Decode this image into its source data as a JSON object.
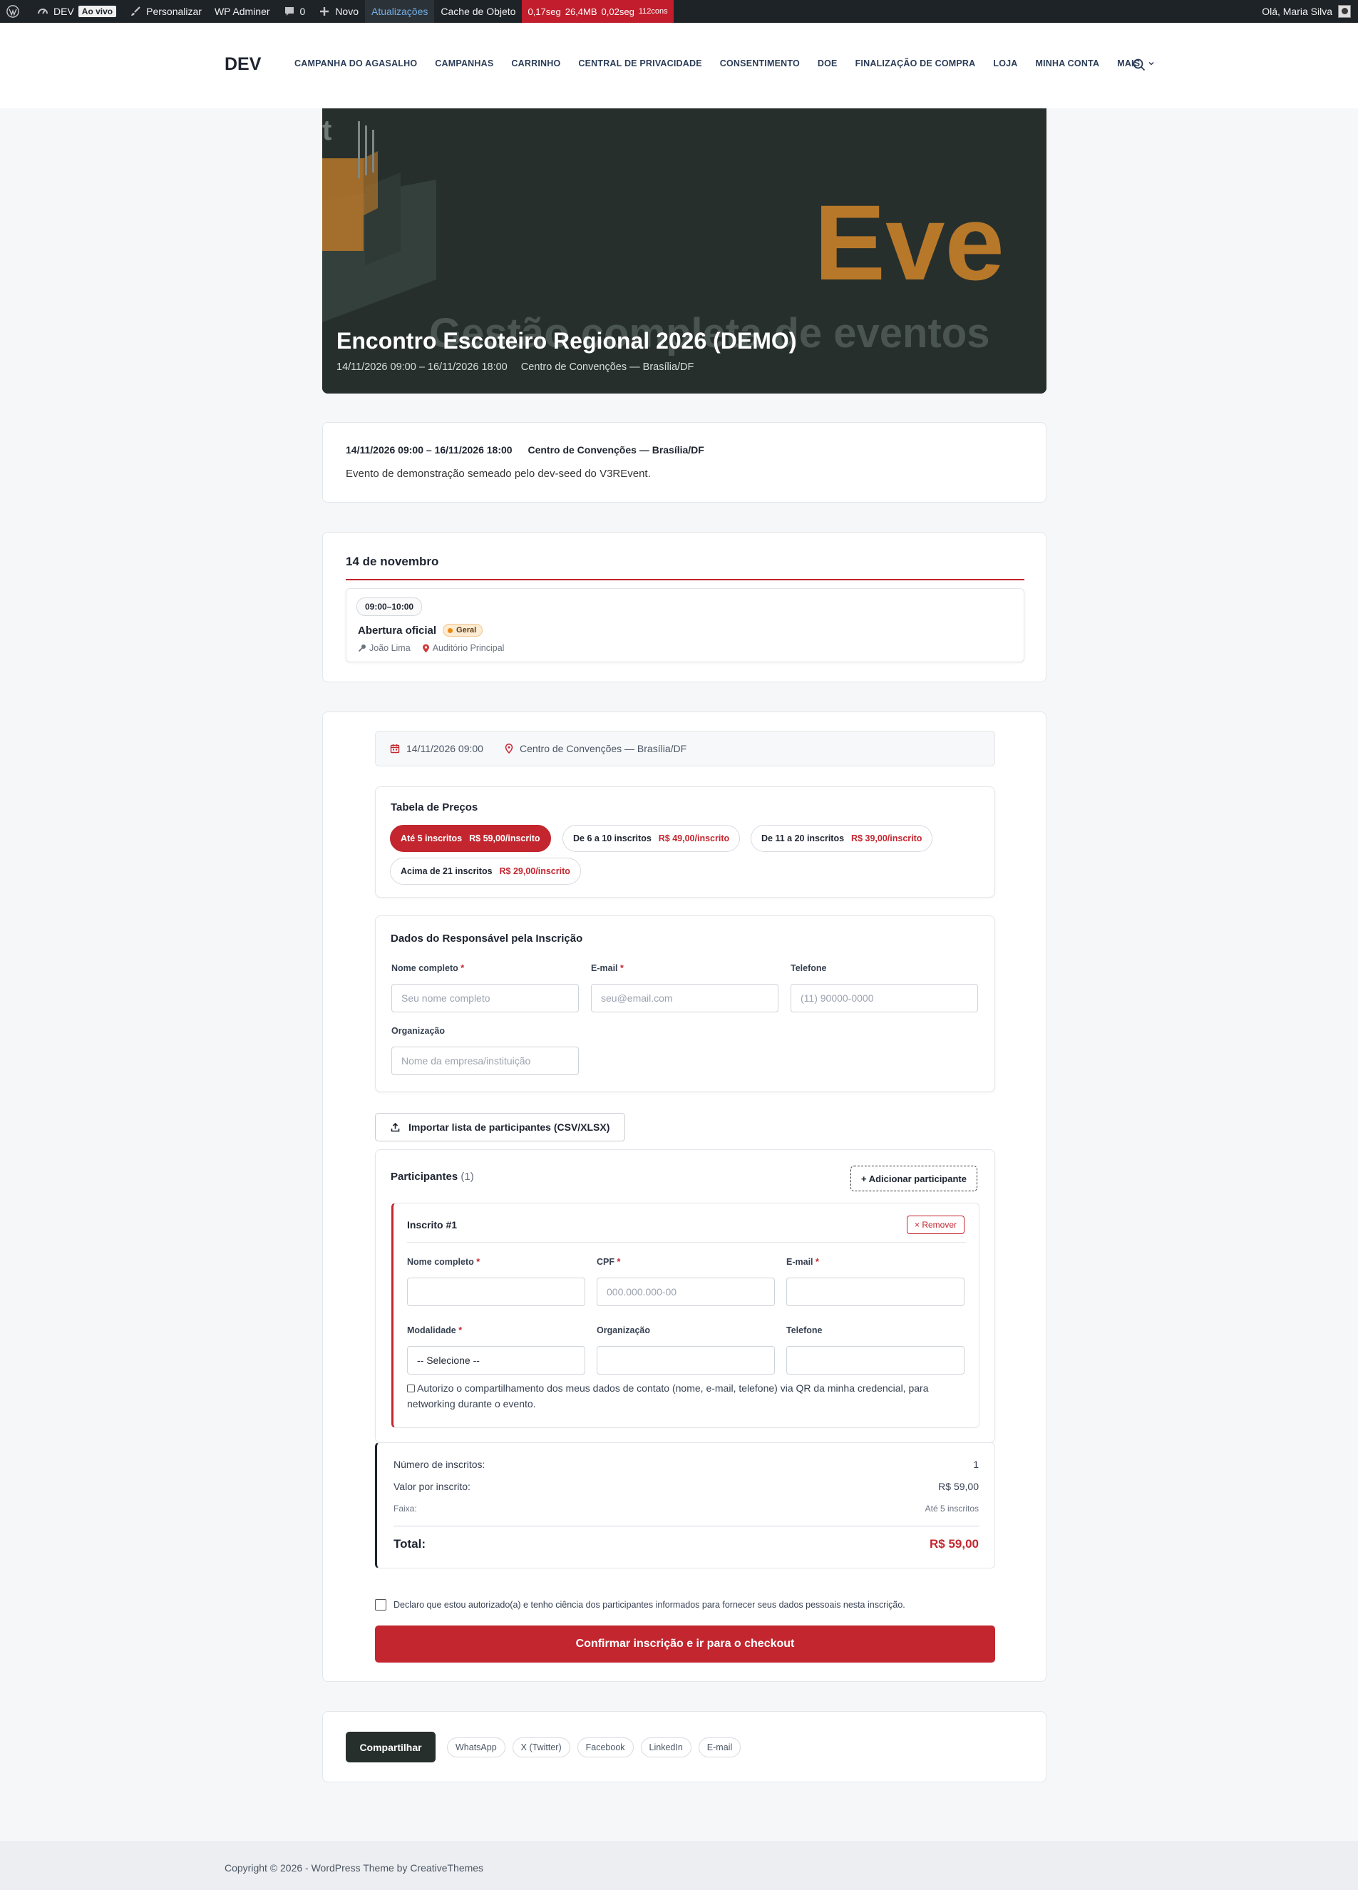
{
  "admin_bar": {
    "site_name": "DEV",
    "live_badge": "Ao vivo",
    "customize": "Personalizar",
    "wp_adminer": "WP Adminer",
    "comments_count": "0",
    "new": "Novo",
    "updates": "Atualizações",
    "object_cache": "Cache de Objeto",
    "perf": {
      "time1": "0,17seg",
      "memory": "26,4MB",
      "time2": "0,02seg",
      "queries": "112cons"
    },
    "greeting": "Olá, Maria Silva"
  },
  "header": {
    "logo": "DEV",
    "nav": [
      "CAMPANHA DO AGASALHO",
      "CAMPANHAS",
      "CARRINHO",
      "CENTRAL DE PRIVACIDADE",
      "CONSENTIMENTO",
      "DOE",
      "FINALIZAÇÃO DE COMPRA",
      "LOJA",
      "MINHA CONTA",
      "MAIS"
    ]
  },
  "hero": {
    "title": "Encontro Escoteiro Regional 2026 (DEMO)",
    "dates": "14/11/2026 09:00 – 16/11/2026 18:00",
    "location": "Centro de Convenções — Brasília/DF",
    "banner_text_big": "Eve",
    "banner_text_sub": "Gestão completa de eventos",
    "banner_corner": "t"
  },
  "info": {
    "dates": "14/11/2026 09:00 – 16/11/2026 18:00",
    "location": "Centro de Convenções — Brasília/DF",
    "description": "Evento de demonstração semeado pelo dev-seed do V3REvent."
  },
  "schedule": {
    "day": "14 de novembro",
    "session": {
      "time": "09:00–10:00",
      "title": "Abertura oficial",
      "category": "Geral",
      "speaker": "João Lima",
      "room": "Auditório Principal"
    }
  },
  "registration": {
    "when_date": "14/11/2026 09:00",
    "when_location": "Centro de Convenções — Brasília/DF",
    "pricing_title": "Tabela de Preços",
    "tiers": [
      {
        "label": "Até 5 inscritos",
        "price": "R$ 59,00/inscrito"
      },
      {
        "label": "De 6 a 10 inscritos",
        "price": "R$ 49,00/inscrito"
      },
      {
        "label": "De 11 a 20 inscritos",
        "price": "R$ 39,00/inscrito"
      },
      {
        "label": "Acima de 21 inscritos",
        "price": "R$ 29,00/inscrito"
      }
    ],
    "responsible": {
      "title": "Dados do Responsável pela Inscrição",
      "name_label": "Nome completo",
      "name_placeholder": "Seu nome completo",
      "email_label": "E-mail",
      "email_placeholder": "seu@email.com",
      "phone_label": "Telefone",
      "phone_placeholder": "(11) 90000-0000",
      "org_label": "Organização",
      "org_placeholder": "Nome da empresa/instituição",
      "required_mark": "*"
    },
    "import_label": "Importar lista de participantes (CSV/XLSX)",
    "participants": {
      "title": "Participantes",
      "count": "(1)",
      "add_label": "+ Adicionar participante",
      "item_title": "Inscrito #1",
      "remove_label": "× Remover",
      "name_label": "Nome completo",
      "cpf_label": "CPF",
      "cpf_placeholder": "000.000.000-00",
      "email_label": "E-mail",
      "modality_label": "Modalidade",
      "modality_value": "-- Selecione --",
      "org_label": "Organização",
      "phone_label": "Telefone",
      "share_consent": "Autorizo o compartilhamento dos meus dados de contato (nome, e-mail, telefone) via QR da minha credencial, para networking durante o evento."
    },
    "summary": {
      "count_label": "Número de inscritos:",
      "count_value": "1",
      "unit_label": "Valor por inscrito:",
      "unit_value": "R$ 59,00",
      "tier_label": "Faixa:",
      "tier_value": "Até 5 inscritos",
      "total_label": "Total:",
      "total_value": "R$ 59,00"
    },
    "declaration": "Declaro que estou autorizado(a) e tenho ciência dos participantes informados para fornecer seus dados pessoais nesta inscrição.",
    "confirm_label": "Confirmar inscrição e ir para o checkout"
  },
  "share": {
    "label": "Compartilhar",
    "links": [
      "WhatsApp",
      "X (Twitter)",
      "Facebook",
      "LinkedIn",
      "E-mail"
    ]
  },
  "footer": {
    "copyright": "Copyright © 2026 - WordPress Theme by CreativeThemes"
  },
  "colors": {
    "accent": "#c3262f",
    "dark": "#262f2c",
    "admin_bar": "#1d2327",
    "banner_orange": "#b8782a"
  }
}
